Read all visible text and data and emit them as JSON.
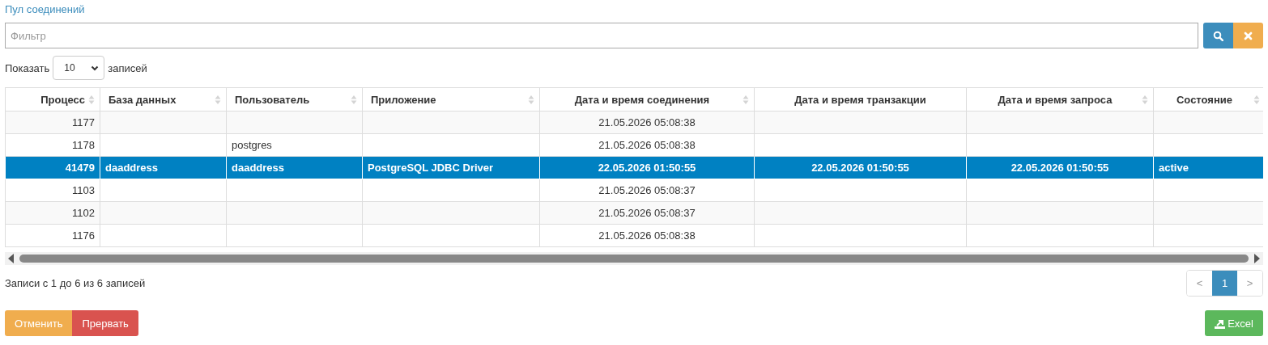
{
  "title": "Пул соединений",
  "filter": {
    "placeholder": "Фильтр"
  },
  "length": {
    "label_before": "Показать",
    "value": "10",
    "label_after": "записей"
  },
  "table": {
    "columns": [
      {
        "label": "Процесс",
        "sortable": true
      },
      {
        "label": "База данных",
        "sortable": true
      },
      {
        "label": "Пользователь",
        "sortable": true
      },
      {
        "label": "Приложение",
        "sortable": true
      },
      {
        "label": "Дата и время соединения",
        "sortable": true
      },
      {
        "label": "Дата и время транзакции",
        "sortable": false
      },
      {
        "label": "Дата и время запроса",
        "sortable": true
      },
      {
        "label": "Состояние",
        "sortable": true
      }
    ],
    "rows": [
      {
        "selected": false,
        "cells": [
          "1177",
          "",
          "",
          "",
          "21.05.2026 05:08:38",
          "",
          "",
          ""
        ]
      },
      {
        "selected": false,
        "cells": [
          "1178",
          "",
          "postgres",
          "",
          "21.05.2026 05:08:38",
          "",
          "",
          ""
        ]
      },
      {
        "selected": true,
        "cells": [
          "41479",
          "daaddress",
          "daaddress",
          "PostgreSQL JDBC Driver",
          "22.05.2026 01:50:55",
          "22.05.2026 01:50:55",
          "22.05.2026 01:50:55",
          "active"
        ]
      },
      {
        "selected": false,
        "cells": [
          "1103",
          "",
          "",
          "",
          "21.05.2026 05:08:37",
          "",
          "",
          ""
        ]
      },
      {
        "selected": false,
        "cells": [
          "1102",
          "",
          "",
          "",
          "21.05.2026 05:08:37",
          "",
          "",
          ""
        ]
      },
      {
        "selected": false,
        "cells": [
          "1176",
          "",
          "",
          "",
          "21.05.2026 05:08:38",
          "",
          "",
          ""
        ]
      }
    ]
  },
  "info": "Записи с 1 до 6 из 6 записей",
  "pagination": [
    {
      "label": "<",
      "selected": false
    },
    {
      "label": "1",
      "selected": true
    },
    {
      "label": ">",
      "selected": false
    }
  ],
  "buttons": [
    {
      "label": "Отменить",
      "kind": "warning"
    },
    {
      "label": "Прервать",
      "kind": "danger"
    }
  ],
  "export": {
    "label": "Excel"
  }
}
